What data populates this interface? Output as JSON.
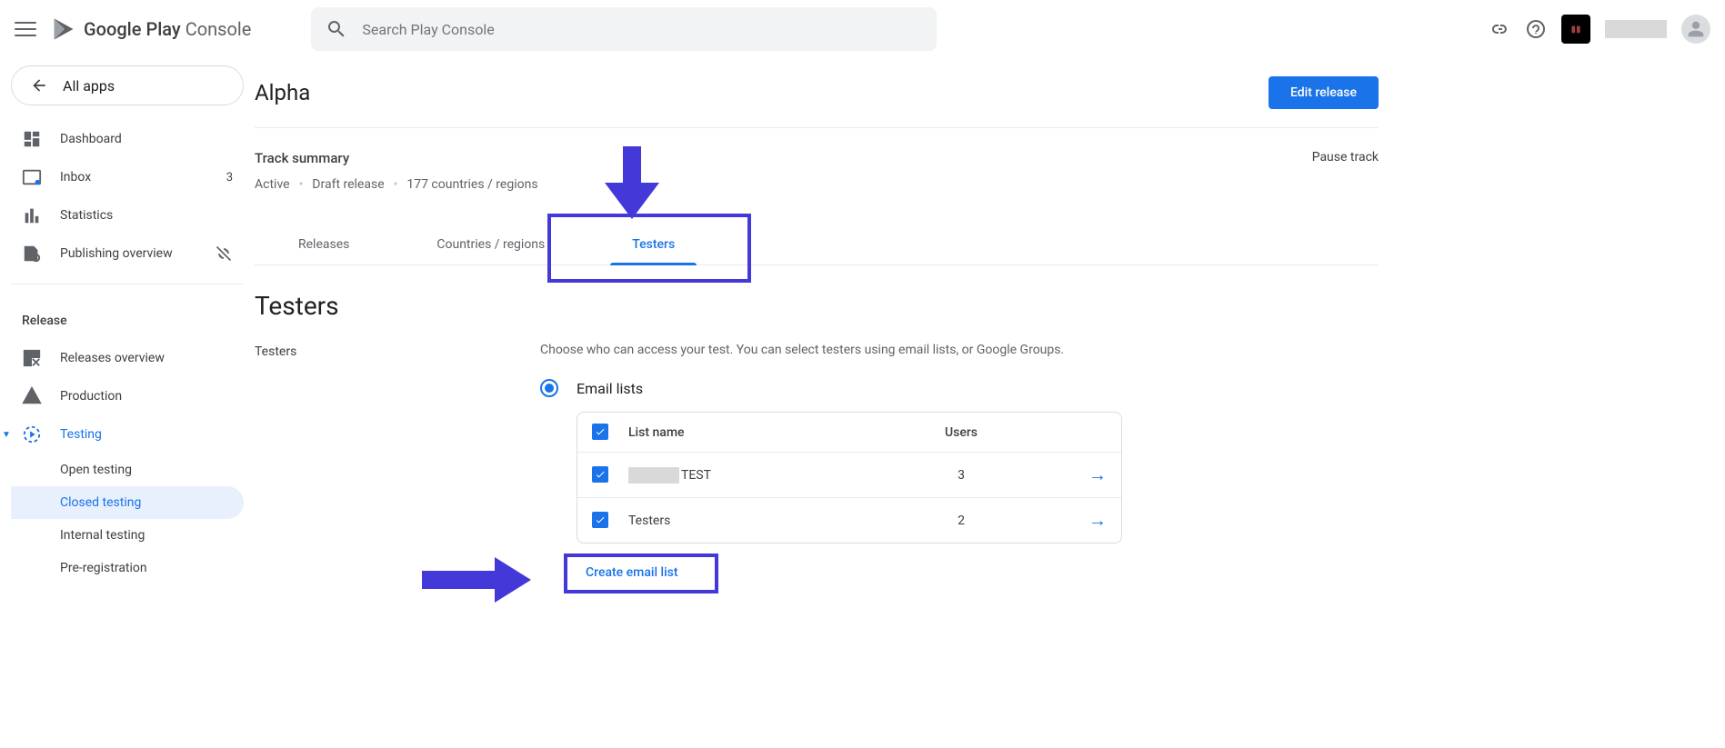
{
  "header": {
    "logo_primary": "Google Play",
    "logo_secondary": " Console",
    "search_placeholder": "Search Play Console"
  },
  "sidebar": {
    "all_apps": "All apps",
    "items": [
      {
        "label": "Dashboard"
      },
      {
        "label": "Inbox",
        "badge": "3"
      },
      {
        "label": "Statistics"
      },
      {
        "label": "Publishing overview"
      }
    ],
    "section_release": "Release",
    "release_items": [
      {
        "label": "Releases overview"
      },
      {
        "label": "Production"
      },
      {
        "label": "Testing"
      },
      {
        "label": "Open testing"
      },
      {
        "label": "Closed testing"
      },
      {
        "label": "Internal testing"
      },
      {
        "label": "Pre-registration"
      }
    ]
  },
  "page": {
    "title": "Alpha",
    "edit_release": "Edit release",
    "track_summary": "Track summary",
    "crumb_status": "Active",
    "crumb_draft": "Draft release",
    "crumb_countries": "177 countries / regions",
    "pause": "Pause track",
    "tabs": [
      "Releases",
      "Countries / regions",
      "Testers"
    ],
    "section_heading": "Testers",
    "form_label": "Testers",
    "help": "Choose who can access your test. You can select testers using email lists, or Google Groups.",
    "radio_label": "Email lists",
    "table_head_name": "List name",
    "table_head_users": "Users",
    "rows": [
      {
        "name_suffix": " TEST",
        "users": "3"
      },
      {
        "name": "Testers",
        "users": "2"
      }
    ],
    "create_link": "Create email list"
  }
}
